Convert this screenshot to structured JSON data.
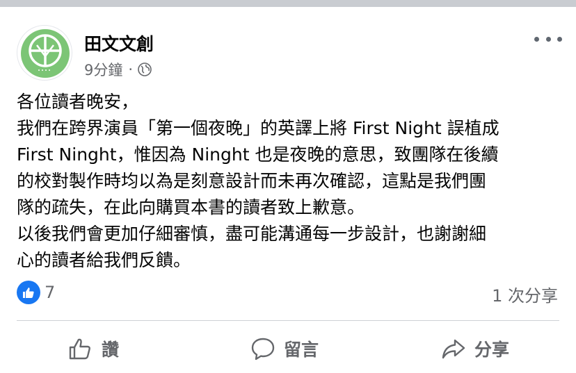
{
  "post": {
    "page_name": "田文文創",
    "time": "9分鐘",
    "separator": "·",
    "audience_icon": "globe-icon",
    "text_lines": [
      "各位讀者晚安，",
      "我們在跨界演員「第一個夜晚」的英譯上將 First Night 誤植成",
      "First Ninght，惟因為 Ninght 也是夜晚的意思，致團隊在後續",
      "的校對製作時均以為是刻意設計而未再次確認，這點是我們團",
      "隊的疏失，在此向購買本書的讀者致上歉意。",
      "以後我們會更加仔細審慎，盡可能溝通每一步設計，也謝謝細",
      "心的讀者給我們反饋。"
    ]
  },
  "stats": {
    "reaction_count": "7",
    "share_count": "1 次分享"
  },
  "actions": {
    "like_label": "讚",
    "comment_label": "留言",
    "share_label": "分享"
  },
  "colors": {
    "brand_blue": "#1877f2",
    "avatar_green": "#7cc576",
    "secondary_text": "#65676b"
  }
}
